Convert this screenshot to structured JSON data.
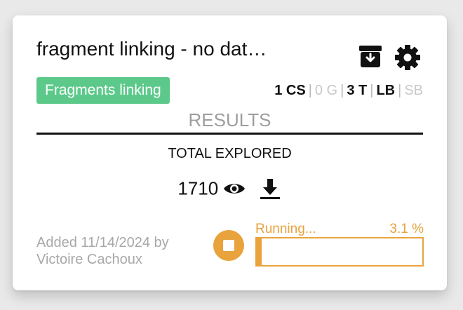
{
  "card": {
    "title": "fragment linking - no dat…",
    "tag": "Fragments linking",
    "flags": [
      {
        "label": "1 CS",
        "active": true
      },
      {
        "label": "0 G",
        "active": false
      },
      {
        "label": "3 T",
        "active": true
      },
      {
        "label": "LB",
        "active": true
      },
      {
        "label": "SB",
        "active": false
      }
    ],
    "flag_separator": "|",
    "results_label": "RESULTS",
    "total_label": "TOTAL EXPLORED",
    "total_value": "1710",
    "added_text": "Added 11/14/2024 by Victoire Cachoux",
    "progress": {
      "status": "Running...",
      "percent_text": "3.1 %",
      "fraction": 0.031
    }
  },
  "icons": {
    "archive": "archive-download-icon",
    "settings": "gear-icon",
    "view": "eye-icon",
    "download": "download-icon",
    "stop": "stop-icon"
  },
  "colors": {
    "tag_bg": "#5cc98a",
    "progress": "#e8a33d",
    "muted": "#a8a8a8"
  }
}
